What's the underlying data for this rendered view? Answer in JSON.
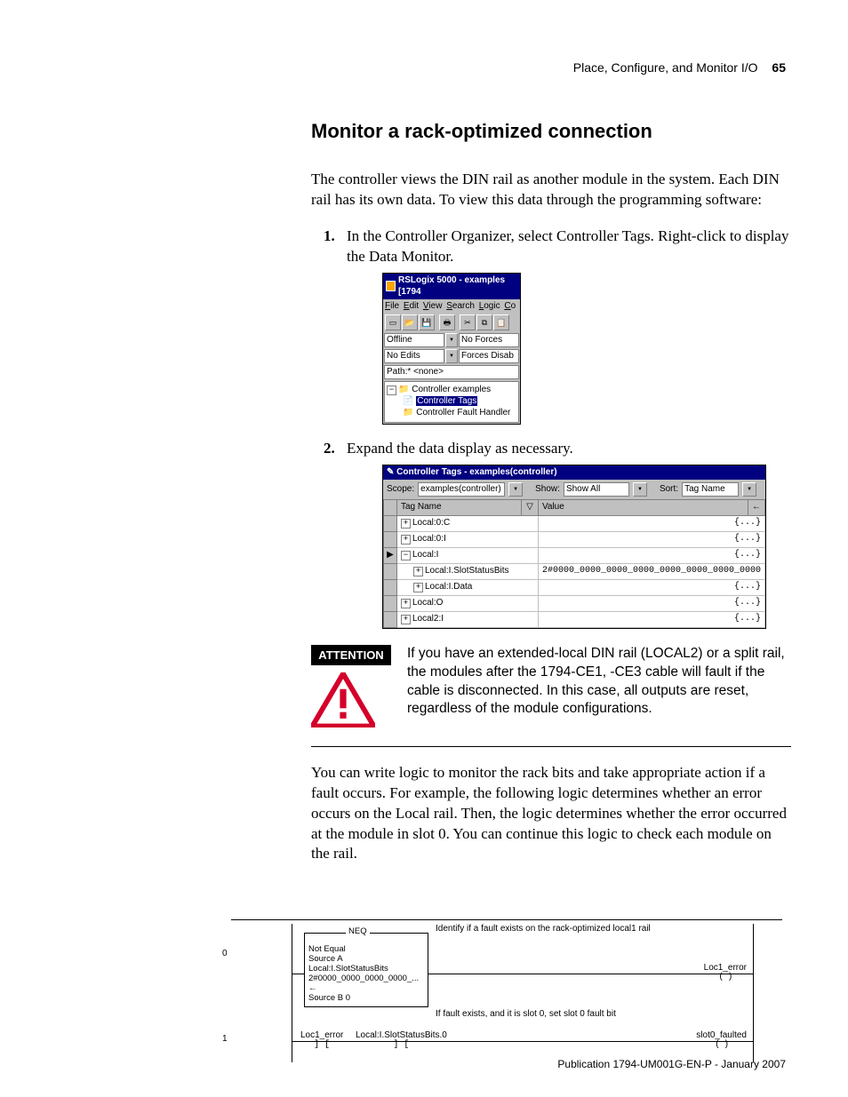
{
  "header": {
    "section": "Place, Configure, and Monitor I/O",
    "page_number": "65"
  },
  "title": "Monitor a rack-optimized connection",
  "intro": "The controller views the DIN rail as another module in the system. Each DIN rail has its own data. To view this data through the programming software:",
  "steps": [
    {
      "num": "1.",
      "text": "In the Controller Organizer, select Controller Tags. Right-click to display the Data Monitor."
    },
    {
      "num": "2.",
      "text": "Expand the data display as necessary."
    }
  ],
  "shot1": {
    "title": "RSLogix 5000 - examples [1794",
    "menus": [
      "File",
      "Edit",
      "View",
      "Search",
      "Logic",
      "Co"
    ],
    "status": {
      "r1a": "Offline",
      "r1b": "No Forces",
      "r2a": "No Edits",
      "r2b": "Forces Disab",
      "path": "Path:* <none>"
    },
    "tree": {
      "root": "Controller examples",
      "sel": "Controller Tags",
      "child": "Controller Fault Handler"
    }
  },
  "shot2": {
    "title": "Controller Tags - examples(controller)",
    "filters": {
      "scope_lbl": "Scope:",
      "scope": "examples(controller)",
      "show_lbl": "Show:",
      "show": "Show All",
      "sort_lbl": "Sort:",
      "sort": "Tag Name"
    },
    "cols": {
      "name": "Tag Name",
      "value": "Value"
    },
    "rows": [
      {
        "lead": "",
        "exp": "+",
        "indent": 0,
        "name": "Local:0:C",
        "value": "{...}"
      },
      {
        "lead": "",
        "exp": "+",
        "indent": 0,
        "name": "Local:0:I",
        "value": "{...}"
      },
      {
        "lead": "▶",
        "exp": "−",
        "indent": 0,
        "name": "Local:I",
        "value": "{...}"
      },
      {
        "lead": "",
        "exp": "+",
        "indent": 1,
        "name": "Local:I.SlotStatusBits",
        "value": "2#0000_0000_0000_0000_0000_0000_0000_0000"
      },
      {
        "lead": "",
        "exp": "+",
        "indent": 1,
        "name": "Local:I.Data",
        "value": "{...}"
      },
      {
        "lead": "",
        "exp": "+",
        "indent": 0,
        "name": "Local:O",
        "value": "{...}"
      },
      {
        "lead": "",
        "exp": "+",
        "indent": 0,
        "name": "Local2:I",
        "value": "{...}"
      }
    ]
  },
  "attention": {
    "label": "ATTENTION",
    "text": "If you have an extended-local DIN rail (LOCAL2) or a split rail, the modules after the 1794-CE1, -CE3 cable will fault if the cable is disconnected. In this case, all outputs are reset, regardless of the module configurations."
  },
  "post_attn": "You can write logic to monitor the rack bits and take appropriate action if a fault occurs. For example, the following logic determines whether an error occurs on the Local rail. Then, the logic determines whether the error occurred at the module in slot 0. You can continue this logic to check each module on the rail.",
  "ladder": {
    "rung0": {
      "num": "0",
      "comment": "Identify if a fault exists on the rack-optimized local1 rail",
      "neq_title": "NEQ",
      "neq_lines": [
        "Not Equal",
        "Source A   Local:I.SlotStatusBits",
        "  2#0000_0000_0000_0000_... ←",
        "Source B                           0"
      ],
      "coil": "Loc1_error"
    },
    "rung1": {
      "num": "1",
      "comment": "If fault exists, and it is slot 0, set slot 0 fault bit",
      "c1": "Loc1_error",
      "c2": "Local:I.SlotStatusBits.0",
      "coil": "slot0_faulted"
    }
  },
  "footer": "Publication 1794-UM001G-EN-P - January 2007"
}
